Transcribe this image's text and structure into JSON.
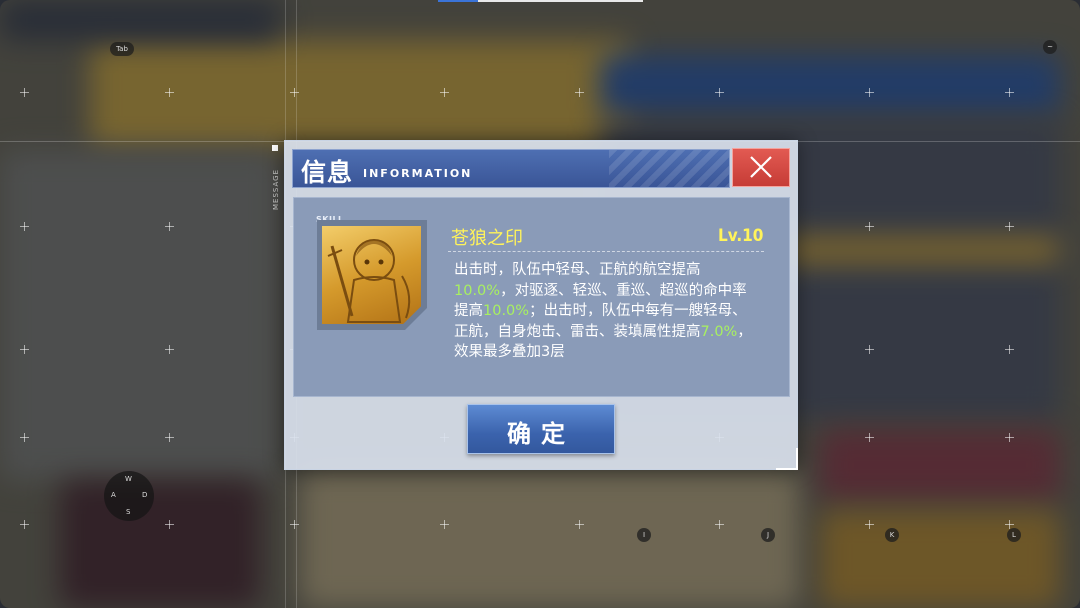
{
  "hud": {
    "side_label": "MESSAGE",
    "joystick": {
      "up": "W",
      "left": "A",
      "right": "D",
      "down": "S"
    },
    "keys": [
      "Tab",
      "~",
      "I",
      "J",
      "K",
      "L"
    ]
  },
  "dialog": {
    "title_cn": "信息",
    "title_en": "INFORMATION",
    "close_icon": "close-icon",
    "skill": {
      "tag": "SKILL",
      "name": "苍狼之印",
      "level": "Lv.10",
      "desc_parts": [
        "出击时，队伍中轻母、正航的航空提高",
        "10.0%",
        "，对驱逐、轻巡、重巡、超巡的命中率提高",
        "10.0%",
        "；出击时，队伍中每有一艘轻母、正航，自身炮击、雷击、装填属性提高",
        "7.0%",
        "，效果最多叠加3层"
      ]
    },
    "confirm_label": "确定"
  },
  "colors": {
    "title_blue": "#3a5597",
    "close_red": "#c63c36",
    "panel": "#8a9bb8",
    "highlight_yellow": "#fff35a",
    "highlight_green": "#a8f060"
  }
}
